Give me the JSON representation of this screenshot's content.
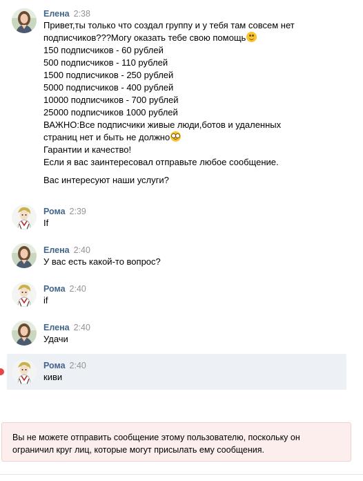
{
  "messages": [
    {
      "author": "Елена",
      "time": "2:38",
      "lines": [
        "Привет,ты только что создал группу и у тебя там совсем нет",
        "подписчиков???Могу оказать тебе свою помощь",
        "150 подписчиков - 60 рублей",
        "500 подписчиков - 110 рублей",
        "1500 подписчиков - 250 рублей",
        "5000 подписчиков - 400 рублей",
        "10000 подписчиков - 700 рублей",
        "25000 подписчиков 1000 рублей",
        "ВАЖНО:Все подписчики живые люди,ботов и удаленных",
        "страниц нет и быть не должно",
        "Гарантии и качество!",
        "Если я вас заинтересовал отправьте любое сообщение.",
        "Вас интересуют наши услуги?"
      ]
    },
    {
      "author": "Рома",
      "time": "2:39",
      "text": "If"
    },
    {
      "author": "Елена",
      "time": "2:40",
      "text": "У вас есть какой-то вопрос?"
    },
    {
      "author": "Рома",
      "time": "2:40",
      "text": "if"
    },
    {
      "author": "Елена",
      "time": "2:40",
      "text": "Удачи"
    },
    {
      "author": "Рома",
      "time": "2:40",
      "text": "киви"
    }
  ],
  "emoji": {
    "smile": "smiling-face-emoji",
    "nerd": "nerd-face-emoji"
  },
  "notice": {
    "line1": "Вы не можете отправить сообщение этому пользователю, поскольку он",
    "line2": "ограничил круг лиц, которые могут присылать ему сообщения."
  },
  "colors": {
    "author": "#42648b",
    "time": "#939393",
    "highlight_bg": "#edf0f5",
    "notice_bg": "#fbeeed",
    "unread": "#e64646"
  }
}
